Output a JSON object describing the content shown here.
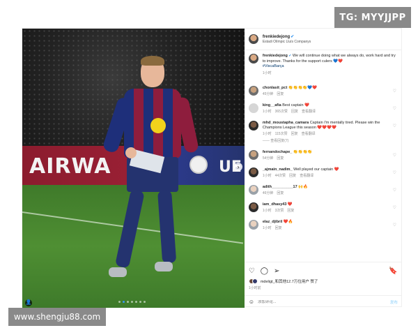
{
  "watermarks": {
    "top": "TG: MYYJJPP",
    "bottom": "www.shengju88.com"
  },
  "photo": {
    "board_text_left": "AIRWA",
    "board_text_right": "UE",
    "carousel_dots": 7,
    "active_dot": 1
  },
  "post": {
    "author": "frenkiedejong",
    "location": "Estadi Olímpic Lluís Companys",
    "caption_user": "frenkiedejong",
    "caption_text": "We will continue doing what we always do, work hard and try to improve. Thanks for the support culers 💙❤️",
    "caption_tag": "#ViscaBarça",
    "caption_time": "1小时"
  },
  "comments": [
    {
      "user": "chonlasit_pct",
      "text": "👏👏👏👏💙❤️",
      "time": "45分钟",
      "reply": "回复",
      "likes": "",
      "avatar": "g"
    },
    {
      "user": "king__afia",
      "text": "Best captain ❤️",
      "time": "1小时",
      "likes": "365次赞",
      "reply": "回复",
      "translate": "查看翻译",
      "avatar": "gray"
    },
    {
      "user": "mhd_moustapha_camara",
      "text": "Captain I'm mentally tired. Please win the Champions League this season ❤️❤️❤️❤️",
      "time": "1小时",
      "likes": "115次赞",
      "reply": "回复",
      "translate": "查看翻译",
      "replies": "—— 查看回复(7)",
      "avatar": "dk"
    },
    {
      "user": "fernandochape_",
      "text": "👏👏👏👏",
      "time": "54分钟",
      "reply": "回复",
      "likes": "",
      "avatar": "g"
    },
    {
      "user": "_ajmain_nadim_",
      "text": "Well played our captain ❤️",
      "time": "1小时",
      "likes": "44次赞",
      "reply": "回复",
      "translate": "查看翻译",
      "avatar": "dk"
    },
    {
      "user": "adith__________17",
      "text": "🙌🔥",
      "time": "46分钟",
      "reply": "回复",
      "likes": "",
      "avatar": "lt"
    },
    {
      "user": "iam_dhasy43",
      "text": "❤️",
      "time": "1小时",
      "likes": "3次赞",
      "reply": "回复",
      "avatar": "dk"
    },
    {
      "user": "elaz_djibril",
      "text": "❤️🔥",
      "time": "1小时",
      "reply": "回复",
      "likes": "",
      "avatar": "lt"
    }
  ],
  "actions": {
    "like_icon": "heart-outline-icon",
    "comment_icon": "comment-bubble-icon",
    "share_icon": "paper-plane-icon",
    "save_icon": "bookmark-icon"
  },
  "likes": {
    "text": "mdeligt_和其他12.7万位用户 赞了",
    "time": "1小时前"
  },
  "comment_box": {
    "placeholder": "添加评论...",
    "post_label": "发布"
  }
}
